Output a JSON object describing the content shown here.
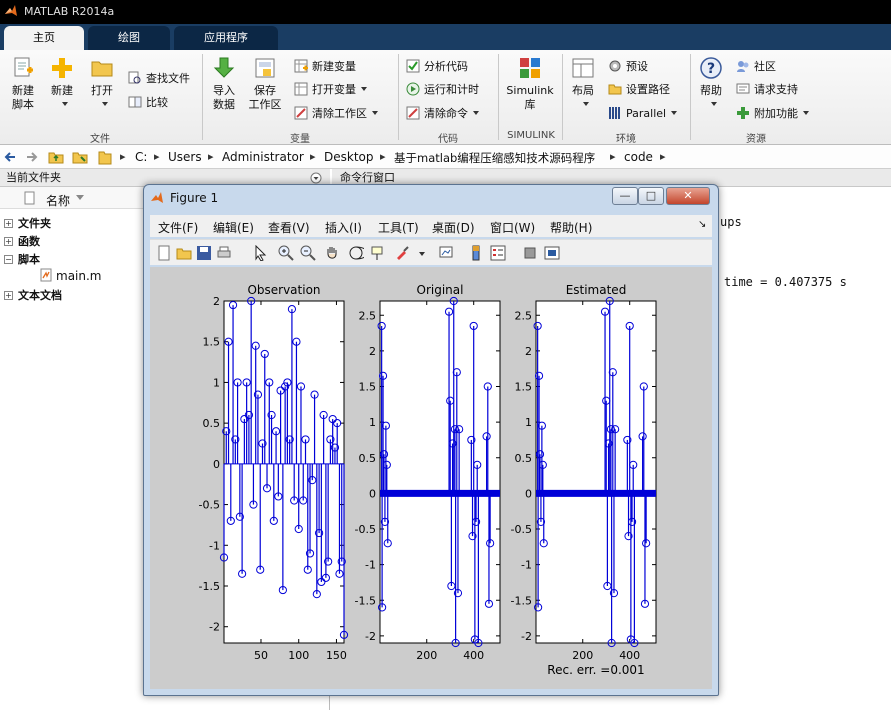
{
  "app": {
    "title": "MATLAB R2014a"
  },
  "tabs": [
    {
      "label": "主页"
    },
    {
      "label": "绘图"
    },
    {
      "label": "应用程序"
    }
  ],
  "ribbon": {
    "new_script": "新建\n脚本",
    "new": "新建",
    "open": "打开",
    "find_files": "查找文件",
    "compare": "比较",
    "group_file": "文件",
    "import_data": "导入\n数据",
    "save_workspace": "保存\n工作区",
    "new_variable": "新建变量",
    "open_variable": "打开变量",
    "clear_workspace": "清除工作区",
    "group_variable": "变量",
    "analyze_code": "分析代码",
    "run_and_time": "运行和计时",
    "clear_commands": "清除命令",
    "group_code": "代码",
    "simulink_library": "Simulink\n库",
    "group_simulink": "SIMULINK",
    "layout": "布局",
    "preferences": "预设",
    "set_path": "设置路径",
    "parallel": "Parallel",
    "group_environment": "环境",
    "help": "帮助",
    "community": "社区",
    "request_support": "请求支持",
    "addons": "附加功能",
    "group_resources": "资源"
  },
  "address": {
    "crumbs": [
      "C:",
      "Users",
      "Administrator",
      "Desktop",
      "基于matlab编程压缩感知技术源码程序",
      "code"
    ]
  },
  "current_folder": {
    "title": "当前文件夹",
    "name_col": "名称",
    "items": [
      {
        "label": "文件夹"
      },
      {
        "label": "函数"
      },
      {
        "label": "脚本"
      },
      {
        "label": "main.m"
      },
      {
        "label": "文本文档"
      }
    ]
  },
  "command_window": {
    "title": "命令行窗口",
    "line1": "ups",
    "line2": "time = 0.407375 s"
  },
  "figure": {
    "title": "Figure 1",
    "menu": [
      "文件(F)",
      "编辑(E)",
      "查看(V)",
      "插入(I)",
      "工具(T)",
      "桌面(D)",
      "窗口(W)",
      "帮助(H)"
    ],
    "win_min": "—",
    "win_max": "□",
    "win_close": "✕"
  },
  "chart_data": [
    {
      "type": "scatter",
      "title": "Observation",
      "xlim": [
        1,
        160
      ],
      "ylim": [
        -2.2,
        2
      ],
      "xticks": [
        50,
        100,
        150
      ],
      "yticks": [
        -2,
        -1.5,
        -1,
        -0.5,
        0,
        0.5,
        1,
        1.5,
        2
      ],
      "x": [
        1,
        4,
        7,
        10,
        13,
        16,
        19,
        22,
        25,
        28,
        31,
        34,
        37,
        40,
        43,
        46,
        49,
        52,
        55,
        58,
        61,
        64,
        67,
        70,
        73,
        76,
        79,
        82,
        85,
        88,
        91,
        94,
        97,
        100,
        103,
        106,
        109,
        112,
        115,
        118,
        121,
        124,
        127,
        130,
        133,
        136,
        139,
        142,
        145,
        148,
        151,
        154,
        157,
        160
      ],
      "y": [
        -1.15,
        0.4,
        1.5,
        -0.7,
        1.95,
        0.3,
        1.0,
        -0.65,
        -1.35,
        0.55,
        1.0,
        0.6,
        2.0,
        -0.5,
        1.45,
        0.85,
        -1.3,
        0.25,
        1.35,
        -0.3,
        1.0,
        0.6,
        -0.7,
        0.4,
        -0.4,
        0.9,
        -1.55,
        0.95,
        1.0,
        0.3,
        1.9,
        -0.45,
        1.5,
        -0.8,
        0.95,
        -0.45,
        0.3,
        -1.3,
        -1.1,
        -0.2,
        0.85,
        -1.6,
        -0.85,
        -1.45,
        0.6,
        -1.4,
        -1.2,
        0.3,
        0.55,
        0.2,
        0.5,
        -1.35,
        -1.2,
        -2.1
      ],
      "marker": "circle",
      "stem": true,
      "color": "#0000d8"
    },
    {
      "type": "scatter",
      "title": "Original",
      "xlim": [
        1,
        512
      ],
      "ylim": [
        -2.1,
        2.7
      ],
      "xticks": [
        200,
        400
      ],
      "yticks": [
        -2,
        -1.5,
        -1,
        -0.5,
        0,
        0.5,
        1,
        1.5,
        2,
        2.5
      ],
      "nonzero": [
        [
          8,
          2.35
        ],
        [
          10,
          -1.6
        ],
        [
          14,
          1.65
        ],
        [
          18,
          0.55
        ],
        [
          22,
          -0.4
        ],
        [
          26,
          0.95
        ],
        [
          30,
          0.4
        ],
        [
          34,
          -0.7
        ],
        [
          295,
          2.55
        ],
        [
          300,
          1.3
        ],
        [
          305,
          -1.3
        ],
        [
          310,
          0.7
        ],
        [
          315,
          2.7
        ],
        [
          320,
          0.9
        ],
        [
          323,
          -2.1
        ],
        [
          328,
          1.7
        ],
        [
          333,
          -1.4
        ],
        [
          338,
          0.9
        ],
        [
          390,
          0.75
        ],
        [
          395,
          -0.6
        ],
        [
          400,
          2.35
        ],
        [
          405,
          -2.05
        ],
        [
          410,
          -0.4
        ],
        [
          415,
          0.4
        ],
        [
          420,
          -2.1
        ],
        [
          455,
          0.8
        ],
        [
          460,
          1.5
        ],
        [
          465,
          -1.55
        ],
        [
          470,
          -0.7
        ]
      ],
      "marker": "circle",
      "stem": true,
      "color": "#0000d8"
    },
    {
      "type": "scatter",
      "title": "Estimated",
      "xlim": [
        1,
        512
      ],
      "ylim": [
        -2.1,
        2.7
      ],
      "xticks": [
        200,
        400
      ],
      "yticks": [
        -2,
        -1.5,
        -1,
        -0.5,
        0,
        0.5,
        1,
        1.5,
        2,
        2.5
      ],
      "xlabel": "Rec. err. =0.001",
      "nonzero": [
        [
          8,
          2.35
        ],
        [
          10,
          -1.6
        ],
        [
          14,
          1.65
        ],
        [
          18,
          0.55
        ],
        [
          22,
          -0.4
        ],
        [
          26,
          0.95
        ],
        [
          30,
          0.4
        ],
        [
          34,
          -0.7
        ],
        [
          295,
          2.55
        ],
        [
          300,
          1.3
        ],
        [
          305,
          -1.3
        ],
        [
          310,
          0.7
        ],
        [
          315,
          2.7
        ],
        [
          320,
          0.9
        ],
        [
          323,
          -2.1
        ],
        [
          328,
          1.7
        ],
        [
          333,
          -1.4
        ],
        [
          338,
          0.9
        ],
        [
          390,
          0.75
        ],
        [
          395,
          -0.6
        ],
        [
          400,
          2.35
        ],
        [
          405,
          -2.05
        ],
        [
          410,
          -0.4
        ],
        [
          415,
          0.4
        ],
        [
          420,
          -2.1
        ],
        [
          455,
          0.8
        ],
        [
          460,
          1.5
        ],
        [
          465,
          -1.55
        ],
        [
          470,
          -0.7
        ]
      ],
      "marker": "circle",
      "stem": true,
      "color": "#0000d8"
    }
  ]
}
